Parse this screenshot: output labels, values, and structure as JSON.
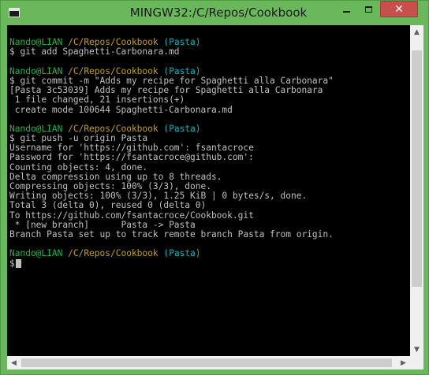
{
  "window": {
    "title": "MINGW32:/C/Repos/Cookbook",
    "controls": {
      "minimize_icon": "minimize-icon",
      "maximize_icon": "maximize-icon",
      "close_icon": "close-icon",
      "close_glyph": "✕"
    }
  },
  "colors": {
    "frame": "#6ab85c",
    "terminal_bg": "#000000",
    "text": "#c0c0c0",
    "prompt_user": "#22b14c",
    "prompt_path": "#c4a000",
    "prompt_branch": "#00b7c3",
    "close_button": "#c7504a"
  },
  "terminal": {
    "lines": [
      "",
      {
        "user": "Nando@LIAN",
        "path": "/C/Repos/Cookbook",
        "branch": "(Pasta)"
      },
      "$ git add Spaghetti-Carbonara.md",
      "",
      {
        "user": "Nando@LIAN",
        "path": "/C/Repos/Cookbook",
        "branch": "(Pasta)"
      },
      "$ git commit -m \"Adds my recipe for Spaghetti alla Carbonara\"",
      "[Pasta 3c53039] Adds my recipe for Spaghetti alla Carbonara",
      " 1 file changed, 21 insertions(+)",
      " create mode 100644 Spaghetti-Carbonara.md",
      "",
      {
        "user": "Nando@LIAN",
        "path": "/C/Repos/Cookbook",
        "branch": "(Pasta)"
      },
      "$ git push -u origin Pasta",
      "Username for 'https://github.com': fsantacroce",
      "Password for 'https://fsantacroce@github.com':",
      "Counting objects: 4, done.",
      "Delta compression using up to 8 threads.",
      "Compressing objects: 100% (3/3), done.",
      "Writing objects: 100% (3/3), 1.25 KiB | 0 bytes/s, done.",
      "Total 3 (delta 0), reused 0 (delta 0)",
      "To https://github.com/fsantacroce/Cookbook.git",
      " * [new branch]      Pasta -> Pasta",
      "Branch Pasta set up to track remote branch Pasta from origin.",
      "",
      {
        "user": "Nando@LIAN",
        "path": "/C/Repos/Cookbook",
        "branch": "(Pasta)"
      },
      {
        "text": "$",
        "cursor": true
      }
    ]
  },
  "scrollbars": {
    "up_arrow": "▲",
    "down_arrow": "▼",
    "left_arrow": "◀",
    "right_arrow": "▶"
  }
}
